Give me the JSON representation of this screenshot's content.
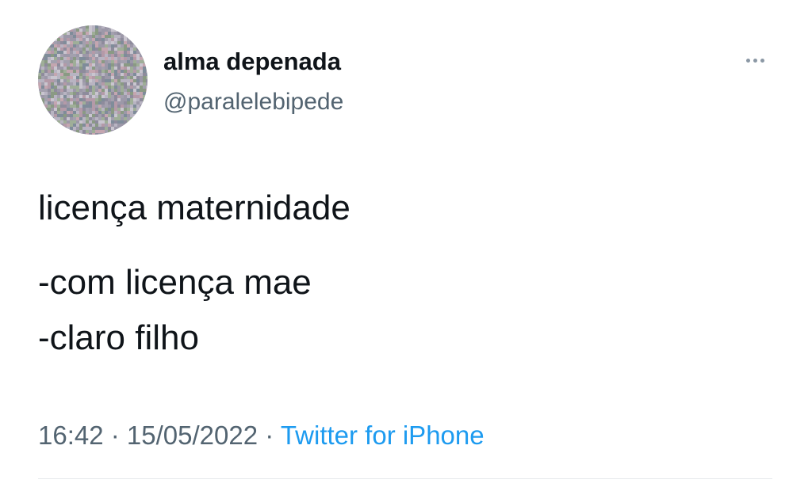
{
  "author": {
    "display_name": "alma depenada",
    "handle": "@paralelebipede",
    "avatar_icon": "pixel-noise-avatar"
  },
  "menu": {
    "icon": "more-horizontal-icon"
  },
  "tweet": {
    "lines": [
      "licença maternidade",
      "-com licença mae",
      "-claro filho"
    ]
  },
  "meta": {
    "time": "16:42",
    "separator1": " · ",
    "date": "15/05/2022",
    "separator2": " · ",
    "source": "Twitter for iPhone"
  },
  "colors": {
    "text_primary": "#0f1419",
    "text_secondary": "#536471",
    "link": "#1d9bf0",
    "divider": "#e6e9eb"
  }
}
